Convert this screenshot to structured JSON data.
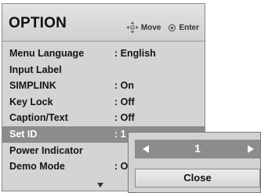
{
  "menu": {
    "title": "OPTION",
    "hints": {
      "move_icon": "four-way-arrow-icon",
      "move_label": "Move",
      "enter_icon": "ok-circle-icon",
      "enter_label": "Enter"
    },
    "items": [
      {
        "label": "Menu Language",
        "value": ": English",
        "selected": false
      },
      {
        "label": "Input Label",
        "value": "",
        "selected": false
      },
      {
        "label": "SIMPLINK",
        "value": ": On",
        "selected": false
      },
      {
        "label": "Key Lock",
        "value": ": Off",
        "selected": false
      },
      {
        "label": "Caption/Text",
        "value": ": Off",
        "selected": false
      },
      {
        "label": "Set ID",
        "value": ": 1",
        "selected": true
      },
      {
        "label": "Power Indicator",
        "value": "",
        "selected": false
      },
      {
        "label": "Demo Mode",
        "value": ": O",
        "selected": false
      }
    ],
    "more_below_icon": "scroll-down-arrow-icon"
  },
  "set_id_popup": {
    "value": "1",
    "left_arrow_icon": "left-arrow-icon",
    "right_arrow_icon": "right-arrow-icon",
    "close_label": "Close"
  },
  "colors": {
    "panel": "#d4d4d4",
    "highlight": "#8c8c8c",
    "highlight_text": "#ffffff",
    "text": "#151515"
  }
}
